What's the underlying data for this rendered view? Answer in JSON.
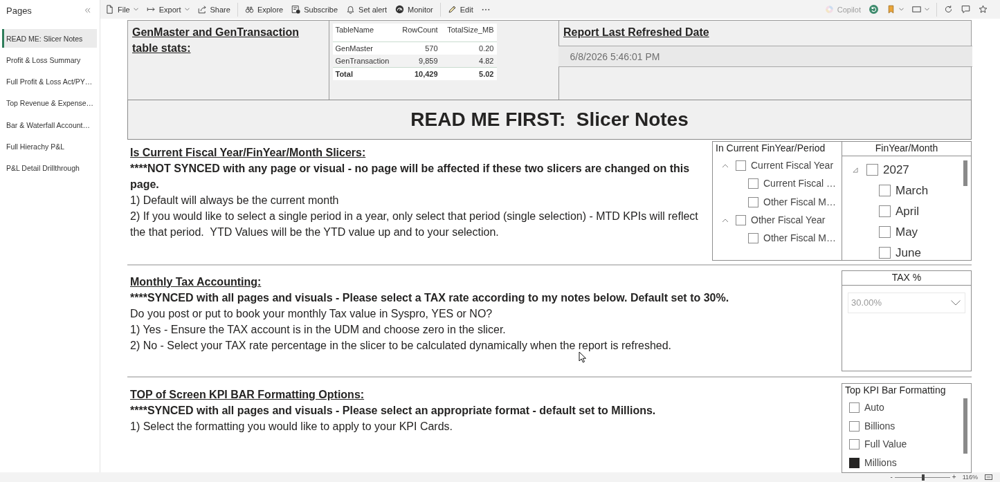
{
  "sidebar": {
    "title": "Pages",
    "pages": [
      {
        "label": "READ ME: Slicer Notes",
        "selected": true
      },
      {
        "label": "Profit & Loss Summary",
        "selected": false
      },
      {
        "label": "Full Profit & Loss Act/PY…",
        "selected": false
      },
      {
        "label": "Top Revenue & Expense…",
        "selected": false
      },
      {
        "label": "Bar & Waterfall Account…",
        "selected": false
      },
      {
        "label": "Full Hierachy P&L",
        "selected": false
      },
      {
        "label": "P&L Detail Drillthrough",
        "selected": false
      }
    ]
  },
  "toolbar": {
    "left": [
      [
        {
          "kind": "file",
          "label": "File",
          "menu": true,
          "disabled": false
        },
        {
          "kind": "export",
          "label": "Export",
          "menu": true,
          "disabled": false
        },
        {
          "kind": "share",
          "label": "Share",
          "menu": false,
          "disabled": false
        }
      ],
      [
        {
          "kind": "explore",
          "label": "Explore",
          "menu": false,
          "disabled": false
        },
        {
          "kind": "subscribe",
          "label": "Subscribe",
          "menu": false,
          "disabled": false
        },
        {
          "kind": "alert",
          "label": "Set alert",
          "menu": false,
          "disabled": false
        },
        {
          "kind": "monitor",
          "label": "Monitor",
          "menu": false,
          "disabled": false
        }
      ],
      [
        {
          "kind": "edit",
          "label": "Edit",
          "menu": false,
          "disabled": false
        },
        {
          "kind": "more",
          "menu": false,
          "disabled": false
        }
      ]
    ],
    "right": [
      [
        {
          "kind": "copilot",
          "label": "Copilot",
          "menu": false,
          "disabled": true
        },
        {
          "kind": "reset",
          "menu": false,
          "disabled": false
        },
        {
          "kind": "bookmark",
          "menu": true,
          "disabled": false
        },
        {
          "kind": "view",
          "menu": true,
          "disabled": false
        }
      ],
      [
        {
          "kind": "refresh",
          "menu": false,
          "disabled": false
        },
        {
          "kind": "comment",
          "menu": false,
          "disabled": false
        },
        {
          "kind": "favorite",
          "menu": false,
          "disabled": false
        }
      ]
    ]
  },
  "stats": {
    "title": "GenMaster and GenTransaction table stats:",
    "table": {
      "columns": [
        "TableName",
        "RowCount",
        "TotalSize_MB"
      ],
      "rows": [
        [
          "GenMaster",
          "570",
          "0.20"
        ],
        [
          "GenTransaction",
          "9,859",
          "4.82"
        ]
      ],
      "total": [
        "Total",
        "10,429",
        "5.02"
      ]
    }
  },
  "refresh": {
    "title": "Report Last Refreshed Date",
    "value": "6/8/2026 5:46:01 PM"
  },
  "banner": {
    "title": "READ ME FIRST:  Slicer Notes"
  },
  "sections": [
    {
      "heading": "Is Current Fiscal Year/FinYear/Month Slicers:",
      "note": "****NOT SYNCED with any page or visual - no page will be affected if these two slicers are changed on this page.",
      "lines": [
        "1) Default will always be the current month",
        "2) If you would like to select a single period in a year, only select that period (single selection) - MTD KPIs will reflect the that period.  YTD Values will be the YTD value up and to your selection."
      ],
      "slicers": [
        {
          "kind": "tree",
          "title": "In Current FinYear/Period",
          "items": [
            {
              "label": "Current Fiscal Year",
              "checked": false,
              "expanded": true,
              "children": [
                {
                  "label": "Current Fiscal …",
                  "checked": false
                },
                {
                  "label": "Other Fiscal M…",
                  "checked": false
                }
              ]
            },
            {
              "label": "Other Fiscal Year",
              "checked": false,
              "expanded": true,
              "children": [
                {
                  "label": "Other Fiscal M…",
                  "checked": false
                }
              ]
            }
          ]
        },
        {
          "kind": "tree",
          "title": "FinYear/Month",
          "items": [
            {
              "label": "2027",
              "checked": false,
              "expanded": true,
              "children": [
                {
                  "label": "March",
                  "checked": false
                },
                {
                  "label": "April",
                  "checked": false
                },
                {
                  "label": "May",
                  "checked": false
                },
                {
                  "label": "June",
                  "checked": false
                }
              ]
            }
          ]
        }
      ]
    },
    {
      "heading": "Monthly Tax Accounting:",
      "note": "****SYNCED with all pages and visuals - Please select a TAX rate according to my notes below. Default set to 30%.",
      "lines": [
        "Do you post or put to book your monthly Tax value in Syspro, YES or NO?",
        "1) Yes - Ensure the TAX account is in the UDM and choose zero in the slicer.",
        "2) No - Select your TAX rate percentage in the slicer to be calculated dynamically when the report is refreshed."
      ],
      "slicers": [
        {
          "kind": "dropdown",
          "title": "TAX %",
          "value": "30.00%"
        }
      ]
    },
    {
      "heading": "TOP of Screen KPI BAR Formatting Options:",
      "note": "****SYNCED with all pages and visuals - Please select an appropriate format - default set to Millions.",
      "lines": [
        "1) Select the formatting you would like to apply to your KPI Cards."
      ],
      "slicers": [
        {
          "kind": "list",
          "title": "Top KPI Bar Formatting",
          "items": [
            {
              "label": "Auto",
              "checked": false
            },
            {
              "label": "Billions",
              "checked": false
            },
            {
              "label": "Full Value",
              "checked": false
            },
            {
              "label": "Millions",
              "checked": true
            }
          ]
        }
      ]
    }
  ],
  "status_bar": {
    "zoom_out": "-",
    "zoom": {
      "level": 0.51
    },
    "zoom_in": "+",
    "zoom_label": "116%"
  }
}
